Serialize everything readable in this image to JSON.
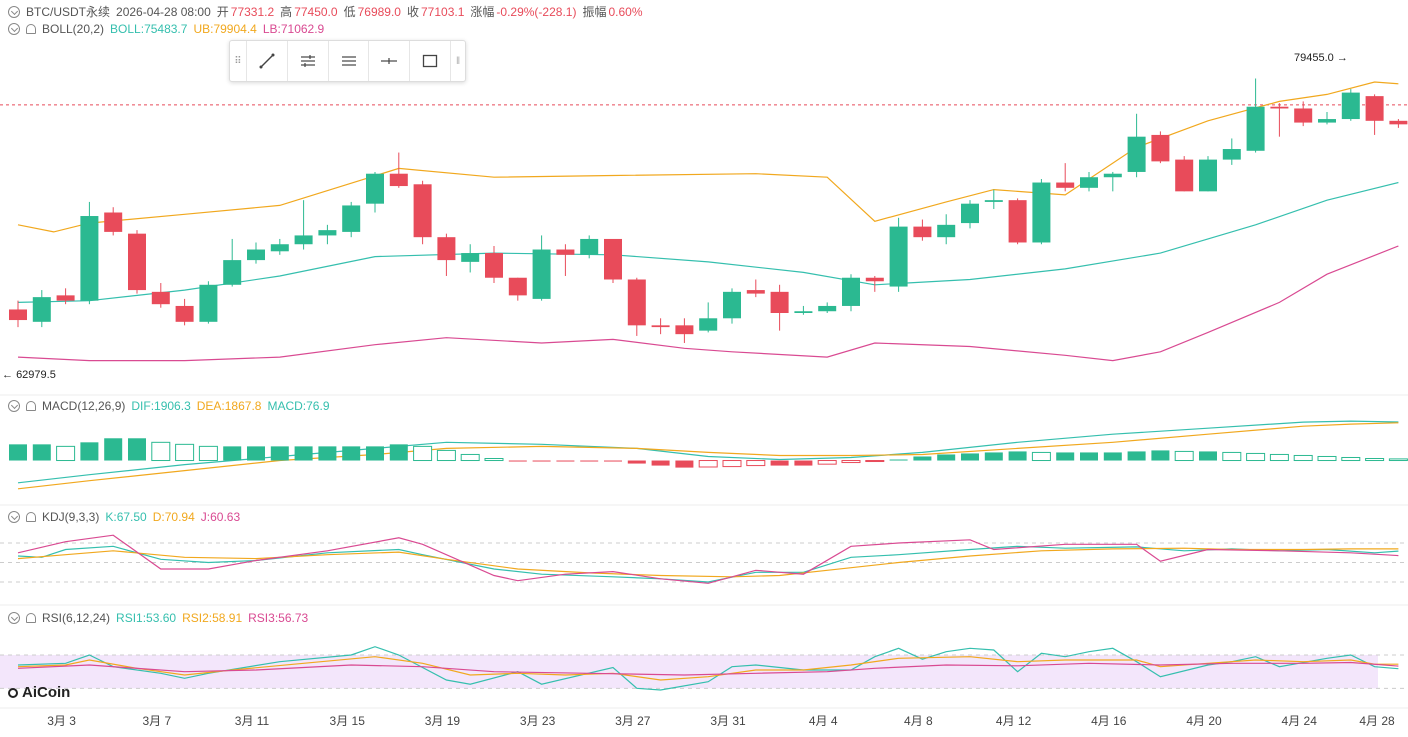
{
  "header": {
    "symbol": "BTC/USDT永续",
    "datetime": "2026-04-28 08:00",
    "open_label": "开",
    "open": "77331.2",
    "high_label": "高",
    "high": "77450.0",
    "low_label": "低",
    "low": "76989.0",
    "close_label": "收",
    "close": "77103.1",
    "change_label": "涨幅",
    "change": "-0.29%(-228.1)",
    "amp_label": "振幅",
    "amp": "0.60%"
  },
  "boll": {
    "label": "BOLL(20,2)",
    "boll": "BOLL:75483.7",
    "ub": "UB:79904.4",
    "lb": "LB:71062.9"
  },
  "macd": {
    "label": "MACD(12,26,9)",
    "dif": "DIF:1906.3",
    "dea": "DEA:1867.8",
    "macd": "MACD:76.9"
  },
  "kdj": {
    "label": "KDJ(9,3,3)",
    "k": "K:67.50",
    "d": "D:70.94",
    "j": "J:60.63"
  },
  "rsi": {
    "label": "RSI(6,12,24)",
    "r1": "RSI1:53.60",
    "r2": "RSI2:58.91",
    "r3": "RSI3:56.73"
  },
  "annotations": {
    "high_price": "79455.0",
    "low_price": "62979.5"
  },
  "logo_text": "AiCoin",
  "toolbar_icons": [
    "grip-icon",
    "trend-line-icon",
    "parallel-lines-icon",
    "horizontal-lines-icon",
    "horizontal-ray-icon",
    "rectangle-icon",
    "more-icon"
  ],
  "colors": {
    "up": "#2bb991",
    "down": "#e84b5a",
    "ub": "#f1a81e",
    "lb": "#d94a92",
    "mid": "#35bfae",
    "rsi_band": "#f3e6fb"
  },
  "chart_data": {
    "type": "candlestick",
    "x_tick_labels": [
      "3月 3",
      "3月 7",
      "3月 11",
      "3月 15",
      "3月 19",
      "3月 23",
      "3月 27",
      "3月 31",
      "4月 4",
      "4月 8",
      "4月 12",
      "4月 16",
      "4月 20",
      "4月 24",
      "4月 28"
    ],
    "candles": [
      {
        "o": 65500,
        "c": 64900,
        "h": 66000,
        "l": 64500
      },
      {
        "o": 64800,
        "c": 66200,
        "h": 66600,
        "l": 64500
      },
      {
        "o": 66300,
        "c": 66000,
        "h": 66700,
        "l": 65800
      },
      {
        "o": 66000,
        "c": 70800,
        "h": 71600,
        "l": 65800
      },
      {
        "o": 71000,
        "c": 69900,
        "h": 71300,
        "l": 69700
      },
      {
        "o": 69800,
        "c": 66600,
        "h": 70000,
        "l": 66400
      },
      {
        "o": 66500,
        "c": 65800,
        "h": 67000,
        "l": 65600
      },
      {
        "o": 65700,
        "c": 64800,
        "h": 66100,
        "l": 64600
      },
      {
        "o": 64800,
        "c": 66900,
        "h": 67100,
        "l": 64700
      },
      {
        "o": 66900,
        "c": 68300,
        "h": 69500,
        "l": 66800
      },
      {
        "o": 68300,
        "c": 68900,
        "h": 69300,
        "l": 68100
      },
      {
        "o": 68800,
        "c": 69200,
        "h": 69500,
        "l": 68600
      },
      {
        "o": 69200,
        "c": 69700,
        "h": 71700,
        "l": 68900
      },
      {
        "o": 69700,
        "c": 70000,
        "h": 70300,
        "l": 69200
      },
      {
        "o": 69900,
        "c": 71400,
        "h": 71600,
        "l": 69600
      },
      {
        "o": 71500,
        "c": 73200,
        "h": 73300,
        "l": 71000
      },
      {
        "o": 73200,
        "c": 72500,
        "h": 74400,
        "l": 72400
      },
      {
        "o": 72600,
        "c": 69600,
        "h": 72800,
        "l": 69200
      },
      {
        "o": 69600,
        "c": 68300,
        "h": 69800,
        "l": 67400
      },
      {
        "o": 68200,
        "c": 68700,
        "h": 69200,
        "l": 67600
      },
      {
        "o": 68700,
        "c": 67300,
        "h": 69100,
        "l": 67000
      },
      {
        "o": 67300,
        "c": 66300,
        "h": 67300,
        "l": 66000
      },
      {
        "o": 66100,
        "c": 68900,
        "h": 69700,
        "l": 66000
      },
      {
        "o": 68900,
        "c": 68600,
        "h": 69200,
        "l": 67400
      },
      {
        "o": 68600,
        "c": 69500,
        "h": 69700,
        "l": 68400
      },
      {
        "o": 69500,
        "c": 67200,
        "h": 69500,
        "l": 67000
      },
      {
        "o": 67200,
        "c": 64600,
        "h": 67300,
        "l": 64000
      },
      {
        "o": 64600,
        "c": 64500,
        "h": 65000,
        "l": 64100
      },
      {
        "o": 64600,
        "c": 64100,
        "h": 65000,
        "l": 63600
      },
      {
        "o": 64300,
        "c": 65000,
        "h": 65900,
        "l": 64200
      },
      {
        "o": 65000,
        "c": 66500,
        "h": 66700,
        "l": 64700
      },
      {
        "o": 66600,
        "c": 66400,
        "h": 67200,
        "l": 66200
      },
      {
        "o": 66500,
        "c": 65300,
        "h": 66900,
        "l": 64300
      },
      {
        "o": 65300,
        "c": 65400,
        "h": 65700,
        "l": 65200
      },
      {
        "o": 65400,
        "c": 65700,
        "h": 65900,
        "l": 65300
      },
      {
        "o": 65700,
        "c": 67300,
        "h": 67500,
        "l": 65400
      },
      {
        "o": 67300,
        "c": 67100,
        "h": 67400,
        "l": 66500
      },
      {
        "o": 66800,
        "c": 70200,
        "h": 70700,
        "l": 66500
      },
      {
        "o": 70200,
        "c": 69600,
        "h": 70600,
        "l": 69400
      },
      {
        "o": 69600,
        "c": 70300,
        "h": 70900,
        "l": 69200
      },
      {
        "o": 70400,
        "c": 71500,
        "h": 71700,
        "l": 70100
      },
      {
        "o": 71600,
        "c": 71700,
        "h": 72300,
        "l": 71200
      },
      {
        "o": 71700,
        "c": 69300,
        "h": 71800,
        "l": 69200
      },
      {
        "o": 69300,
        "c": 72700,
        "h": 72900,
        "l": 69200
      },
      {
        "o": 72700,
        "c": 72400,
        "h": 73800,
        "l": 72200
      },
      {
        "o": 72400,
        "c": 73000,
        "h": 73300,
        "l": 72200
      },
      {
        "o": 73000,
        "c": 73200,
        "h": 73300,
        "l": 72200
      },
      {
        "o": 73300,
        "c": 75300,
        "h": 76600,
        "l": 73000
      },
      {
        "o": 75400,
        "c": 73900,
        "h": 75600,
        "l": 73800
      },
      {
        "o": 74000,
        "c": 72200,
        "h": 74200,
        "l": 72200
      },
      {
        "o": 72200,
        "c": 74000,
        "h": 74200,
        "l": 72200
      },
      {
        "o": 74000,
        "c": 74600,
        "h": 75200,
        "l": 73700
      },
      {
        "o": 74500,
        "c": 77000,
        "h": 78600,
        "l": 74400
      },
      {
        "o": 77000,
        "c": 76900,
        "h": 77200,
        "l": 75300
      },
      {
        "o": 76900,
        "c": 76100,
        "h": 77300,
        "l": 75900
      },
      {
        "o": 76100,
        "c": 76300,
        "h": 76700,
        "l": 76000
      },
      {
        "o": 76300,
        "c": 77800,
        "h": 78000,
        "l": 76200
      },
      {
        "o": 77600,
        "c": 76200,
        "h": 77700,
        "l": 75400
      },
      {
        "o": 76200,
        "c": 76000,
        "h": 76300,
        "l": 75800
      }
    ],
    "boll_upper": [
      [
        0,
        70300
      ],
      [
        1.5,
        69900
      ],
      [
        3,
        70400
      ],
      [
        7,
        70900
      ],
      [
        11,
        71400
      ],
      [
        16,
        73500
      ],
      [
        20,
        73000
      ],
      [
        25,
        73100
      ],
      [
        31,
        73200
      ],
      [
        34,
        73000
      ],
      [
        36,
        70500
      ],
      [
        39,
        71600
      ],
      [
        41,
        72300
      ],
      [
        44,
        72000
      ],
      [
        47,
        74700
      ],
      [
        50,
        76200
      ],
      [
        53,
        77300
      ],
      [
        55,
        77700
      ],
      [
        57,
        78400
      ],
      [
        58,
        78300
      ]
    ],
    "boll_mid": [
      [
        0,
        65900
      ],
      [
        3,
        66000
      ],
      [
        7,
        66600
      ],
      [
        11,
        67400
      ],
      [
        15,
        68500
      ],
      [
        20,
        68700
      ],
      [
        25,
        68600
      ],
      [
        29,
        68200
      ],
      [
        33,
        67600
      ],
      [
        36,
        66900
      ],
      [
        40,
        67200
      ],
      [
        44,
        67800
      ],
      [
        48,
        68700
      ],
      [
        52,
        70300
      ],
      [
        55,
        71700
      ],
      [
        58,
        72700
      ]
    ],
    "boll_lower": [
      [
        0,
        62800
      ],
      [
        3,
        62600
      ],
      [
        7,
        62600
      ],
      [
        11,
        62800
      ],
      [
        15,
        63500
      ],
      [
        18,
        63900
      ],
      [
        22,
        63600
      ],
      [
        25,
        63800
      ],
      [
        28,
        63300
      ],
      [
        30,
        63100
      ],
      [
        34,
        62800
      ],
      [
        36,
        63600
      ],
      [
        40,
        63400
      ],
      [
        44,
        62900
      ],
      [
        46,
        62600
      ],
      [
        48,
        63100
      ],
      [
        50,
        64200
      ],
      [
        53,
        65900
      ],
      [
        55,
        67500
      ],
      [
        58,
        69100
      ]
    ],
    "macd_hist": [
      800,
      800,
      700,
      900,
      1100,
      1100,
      900,
      800,
      700,
      700,
      700,
      700,
      700,
      700,
      700,
      700,
      800,
      700,
      500,
      300,
      100,
      -30,
      -40,
      -40,
      -40,
      -50,
      -150,
      -250,
      -350,
      -320,
      -300,
      -250,
      -250,
      -250,
      -180,
      -100,
      -30,
      50,
      200,
      300,
      350,
      400,
      450,
      400,
      400,
      400,
      400,
      450,
      500,
      450,
      450,
      400,
      350,
      300,
      250,
      200,
      150,
      100,
      80
    ],
    "macd_dif": [
      [
        0,
        -1100
      ],
      [
        3,
        -700
      ],
      [
        7,
        -200
      ],
      [
        11,
        200
      ],
      [
        15,
        600
      ],
      [
        18,
        900
      ],
      [
        22,
        800
      ],
      [
        26,
        600
      ],
      [
        29,
        200
      ],
      [
        32,
        50
      ],
      [
        35,
        150
      ],
      [
        38,
        400
      ],
      [
        42,
        900
      ],
      [
        46,
        1300
      ],
      [
        50,
        1600
      ],
      [
        54,
        1900
      ],
      [
        56,
        1950
      ],
      [
        58,
        1906
      ]
    ],
    "macd_dea": [
      [
        0,
        -1400
      ],
      [
        3,
        -1000
      ],
      [
        7,
        -500
      ],
      [
        11,
        0
      ],
      [
        15,
        300
      ],
      [
        18,
        600
      ],
      [
        22,
        700
      ],
      [
        26,
        600
      ],
      [
        29,
        400
      ],
      [
        32,
        250
      ],
      [
        35,
        250
      ],
      [
        38,
        300
      ],
      [
        42,
        600
      ],
      [
        46,
        900
      ],
      [
        50,
        1300
      ],
      [
        54,
        1700
      ],
      [
        56,
        1800
      ],
      [
        58,
        1867
      ]
    ],
    "kdj_k": [
      [
        0,
        60
      ],
      [
        1,
        58
      ],
      [
        2,
        70
      ],
      [
        4,
        75
      ],
      [
        6,
        55
      ],
      [
        8,
        50
      ],
      [
        10,
        53
      ],
      [
        13,
        65
      ],
      [
        16,
        70
      ],
      [
        17,
        62
      ],
      [
        20,
        40
      ],
      [
        22,
        32
      ],
      [
        25,
        28
      ],
      [
        27,
        25
      ],
      [
        29,
        20
      ],
      [
        31,
        35
      ],
      [
        33,
        35
      ],
      [
        35,
        58
      ],
      [
        37,
        62
      ],
      [
        40,
        70
      ],
      [
        42,
        75
      ],
      [
        44,
        72
      ],
      [
        47,
        74
      ],
      [
        49,
        68
      ],
      [
        51,
        71
      ],
      [
        53,
        68
      ],
      [
        55,
        70
      ],
      [
        57,
        65
      ],
      [
        58,
        67.5
      ]
    ],
    "kdj_d": [
      [
        0,
        56
      ],
      [
        2,
        62
      ],
      [
        4,
        68
      ],
      [
        7,
        58
      ],
      [
        10,
        56
      ],
      [
        13,
        62
      ],
      [
        16,
        66
      ],
      [
        18,
        55
      ],
      [
        21,
        40
      ],
      [
        24,
        34
      ],
      [
        27,
        30
      ],
      [
        30,
        28
      ],
      [
        32,
        30
      ],
      [
        34,
        38
      ],
      [
        37,
        50
      ],
      [
        40,
        60
      ],
      [
        43,
        68
      ],
      [
        46,
        71
      ],
      [
        49,
        72
      ],
      [
        51,
        70
      ],
      [
        54,
        70
      ],
      [
        56,
        71
      ],
      [
        58,
        70.94
      ]
    ],
    "kdj_j": [
      [
        0,
        65
      ],
      [
        2,
        82
      ],
      [
        4,
        92
      ],
      [
        6,
        40
      ],
      [
        8,
        40
      ],
      [
        10,
        53
      ],
      [
        13,
        68
      ],
      [
        16,
        88
      ],
      [
        17,
        78
      ],
      [
        20,
        30
      ],
      [
        21,
        22
      ],
      [
        23,
        32
      ],
      [
        25,
        36
      ],
      [
        27,
        25
      ],
      [
        29,
        18
      ],
      [
        31,
        38
      ],
      [
        33,
        32
      ],
      [
        35,
        75
      ],
      [
        37,
        80
      ],
      [
        40,
        85
      ],
      [
        41,
        70
      ],
      [
        44,
        78
      ],
      [
        47,
        78
      ],
      [
        48,
        52
      ],
      [
        50,
        70
      ],
      [
        53,
        68
      ],
      [
        56,
        65
      ],
      [
        58,
        60.63
      ]
    ],
    "rsi1": [
      [
        0,
        58
      ],
      [
        2,
        60
      ],
      [
        3,
        70
      ],
      [
        4,
        56
      ],
      [
        6,
        48
      ],
      [
        7,
        42
      ],
      [
        8,
        48
      ],
      [
        11,
        62
      ],
      [
        14,
        70
      ],
      [
        15,
        80
      ],
      [
        16,
        70
      ],
      [
        18,
        40
      ],
      [
        19,
        35
      ],
      [
        21,
        50
      ],
      [
        22,
        35
      ],
      [
        25,
        55
      ],
      [
        26,
        30
      ],
      [
        27,
        28
      ],
      [
        29,
        38
      ],
      [
        30,
        56
      ],
      [
        31,
        58
      ],
      [
        33,
        52
      ],
      [
        35,
        52
      ],
      [
        36,
        68
      ],
      [
        37,
        78
      ],
      [
        38,
        65
      ],
      [
        39,
        74
      ],
      [
        40,
        78
      ],
      [
        41,
        76
      ],
      [
        42,
        50
      ],
      [
        43,
        72
      ],
      [
        44,
        68
      ],
      [
        45,
        74
      ],
      [
        46,
        78
      ],
      [
        47,
        62
      ],
      [
        48,
        44
      ],
      [
        50,
        58
      ],
      [
        51,
        62
      ],
      [
        52,
        68
      ],
      [
        53,
        56
      ],
      [
        55,
        66
      ],
      [
        56,
        70
      ],
      [
        57,
        56
      ],
      [
        58,
        53.6
      ]
    ],
    "rsi2": [
      [
        0,
        56
      ],
      [
        2,
        58
      ],
      [
        3,
        64
      ],
      [
        5,
        54
      ],
      [
        7,
        46
      ],
      [
        9,
        52
      ],
      [
        12,
        60
      ],
      [
        15,
        68
      ],
      [
        17,
        60
      ],
      [
        19,
        46
      ],
      [
        21,
        48
      ],
      [
        23,
        46
      ],
      [
        25,
        48
      ],
      [
        27,
        40
      ],
      [
        29,
        44
      ],
      [
        31,
        52
      ],
      [
        33,
        52
      ],
      [
        35,
        58
      ],
      [
        37,
        66
      ],
      [
        40,
        68
      ],
      [
        42,
        62
      ],
      [
        44,
        64
      ],
      [
        47,
        64
      ],
      [
        48,
        56
      ],
      [
        50,
        60
      ],
      [
        52,
        64
      ],
      [
        54,
        62
      ],
      [
        56,
        64
      ],
      [
        57,
        59
      ],
      [
        58,
        58.91
      ]
    ],
    "rsi3": [
      [
        0,
        54
      ],
      [
        3,
        58
      ],
      [
        7,
        50
      ],
      [
        10,
        52
      ],
      [
        14,
        58
      ],
      [
        17,
        56
      ],
      [
        20,
        50
      ],
      [
        24,
        48
      ],
      [
        28,
        46
      ],
      [
        31,
        48
      ],
      [
        34,
        50
      ],
      [
        36,
        54
      ],
      [
        39,
        58
      ],
      [
        42,
        57
      ],
      [
        45,
        60
      ],
      [
        48,
        58
      ],
      [
        51,
        60
      ],
      [
        54,
        60
      ],
      [
        56,
        61
      ],
      [
        58,
        56.73
      ]
    ],
    "price_range": [
      61500,
      80500
    ],
    "macd_range": [
      -2200,
      2400
    ],
    "kdj_range": [
      0,
      100
    ],
    "rsi_range": [
      10,
      100
    ],
    "current_price": 77103.1,
    "rsi_band": [
      30,
      70
    ]
  }
}
